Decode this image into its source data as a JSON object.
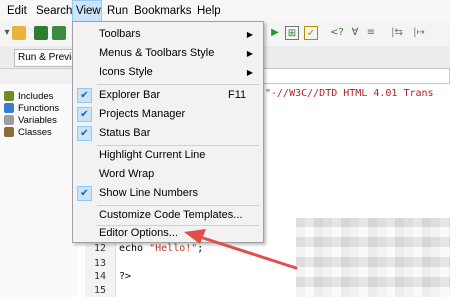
{
  "menubar": {
    "items": [
      "Edit",
      "Search",
      "View",
      "Run",
      "Bookmarks",
      "Help"
    ]
  },
  "tabs": {
    "run_preview": "Run & Preview"
  },
  "sidebar": {
    "items": [
      "Includes",
      "Functions",
      "Variables",
      "Classes"
    ]
  },
  "editor": {
    "doctype_line": "\"-//W3C//DTD HTML 4.01 Trans",
    "line_numbers": [
      "12",
      "13",
      "14",
      "15"
    ],
    "lines": [
      "echo \"Hello!\";",
      "",
      "?>",
      ""
    ]
  },
  "view_menu": {
    "items": [
      {
        "label": "Toolbars",
        "submenu": true
      },
      {
        "label": "Menus & Toolbars Style",
        "submenu": true
      },
      {
        "label": "Icons Style",
        "submenu": true
      },
      {
        "label": "Explorer Bar",
        "checked": true,
        "shortcut": "F11"
      },
      {
        "label": "Projects Manager",
        "checked": true
      },
      {
        "label": "Status Bar",
        "checked": true
      },
      {
        "label": "Highlight Current Line"
      },
      {
        "label": "Word Wrap"
      },
      {
        "label": "Show Line Numbers",
        "checked": true
      },
      {
        "label": "Customize Code Templates..."
      },
      {
        "label": "Editor Options..."
      }
    ]
  },
  "colors": {
    "menu_highlight": "#cce4f7",
    "annotation_arrow": "#e0504a"
  }
}
